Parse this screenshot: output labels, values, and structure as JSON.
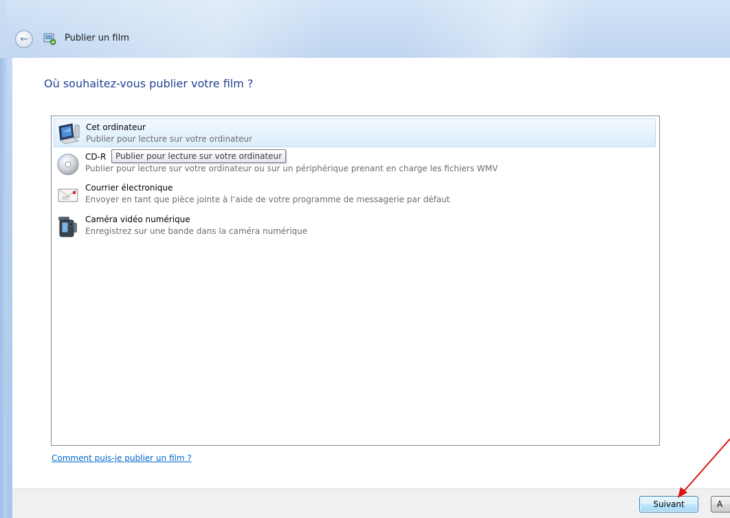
{
  "window": {
    "title": "Publier un film",
    "back_icon": "back-arrow-icon",
    "app_icon": "movie-publish-icon"
  },
  "main": {
    "heading": "Où souhaitez-vous publier votre film ?",
    "options": [
      {
        "title": "Cet ordinateur",
        "description": "Publier pour lecture sur votre ordinateur",
        "icon": "computer-icon",
        "selected": true
      },
      {
        "title": "CD-R",
        "description": "Publier pour lecture sur votre ordinateur ou sur un périphérique prenant en charge les fichiers WMV",
        "icon": "cd-icon",
        "selected": false
      },
      {
        "title": "Courrier électronique",
        "description": "Envoyer en tant que pièce jointe à l’aide de votre programme de messagerie par défaut",
        "icon": "email-icon",
        "selected": false
      },
      {
        "title": "Caméra vidéo numérique",
        "description": "Enregistrez sur une bande dans la caméra numérique",
        "icon": "camcorder-icon",
        "selected": false
      }
    ],
    "tooltip": "Publier pour lecture sur votre ordinateur",
    "help_link": "Comment puis-je publier un film ?"
  },
  "footer": {
    "next_label": "Suivant",
    "cancel_label": "A"
  },
  "colors": {
    "heading": "#1e3f8f",
    "link": "#0066cc",
    "selection": "#dbeefc",
    "annotation_arrow": "#e01010"
  }
}
